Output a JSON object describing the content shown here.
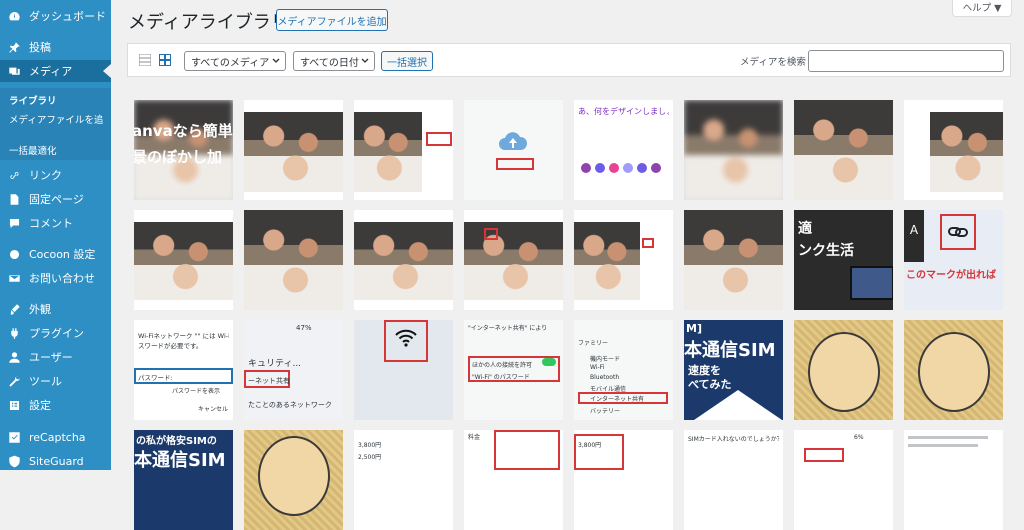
{
  "sidebar": {
    "items": [
      {
        "label": "ダッシュボード",
        "icon": "dashboard-icon"
      },
      {
        "label": "投稿",
        "icon": "pin-icon"
      },
      {
        "label": "メディア",
        "icon": "media-icon"
      },
      {
        "label": "リンク",
        "icon": "link-icon"
      },
      {
        "label": "固定ページ",
        "icon": "page-icon"
      },
      {
        "label": "コメント",
        "icon": "comment-icon"
      },
      {
        "label": "Cocoon 設定",
        "icon": "cocoon-icon"
      },
      {
        "label": "お問い合わせ",
        "icon": "mail-icon"
      },
      {
        "label": "外観",
        "icon": "brush-icon"
      },
      {
        "label": "プラグイン",
        "icon": "plugin-icon"
      },
      {
        "label": "ユーザー",
        "icon": "user-icon"
      },
      {
        "label": "ツール",
        "icon": "wrench-icon"
      },
      {
        "label": "設定",
        "icon": "settings-icon"
      },
      {
        "label": "reCaptcha",
        "icon": "check-icon"
      },
      {
        "label": "SiteGuard",
        "icon": "shield-icon"
      }
    ],
    "submenu": [
      "ライブラリ",
      "メディアファイルを追",
      "一括最適化"
    ]
  },
  "header": {
    "title": "メディアライブラリ",
    "add_new": "メディアファイルを追加",
    "help": "ヘルプ ▼"
  },
  "filters": {
    "type": "すべてのメディア",
    "date": "すべての日付",
    "bulk_select": "一括選択",
    "search_label": "メディアを検索",
    "search_value": ""
  },
  "thumbs": {
    "canva_line1": "anvaなら簡単",
    "canva_line2": "景のぼかし加",
    "wifi_title": "Wi-Fiネットワーク \"\" には Wi-Fi",
    "wifi_sub": "スワードが必要です。",
    "wifi_pass_label": "パスワード:",
    "wifi_show": "パスワードを表示",
    "wifi_cancel": "キャンセル",
    "security": "キュリティ...",
    "net_share": "ーネット共有",
    "network_text": "たことのあるネットワーク",
    "battery": "47%",
    "sim_label": "M]",
    "sim_line1": "本通信SIM",
    "sim_line2": "速度を",
    "sim_line3": "べてみた",
    "sim2_line1": "の私が格安SIMの",
    "sim2_line2": "本通信SIM",
    "canva2": "あ、何をデザインしましょう",
    "link_text": "このマークが出れば",
    "tech1": "適",
    "tech2": "ンク生活",
    "letter_a": "A",
    "internet_share": "インターネット共有",
    "settings_rows": [
      "機内モード",
      "Wi-Fi",
      "Bluetooth",
      "モバイル通信",
      "インターネット共有",
      "バッテリー"
    ],
    "family": "ファミリー",
    "pref1": "ほかの人の接続を許可",
    "pref2": "\"Wi-Fi\" のパスワード",
    "pref_head": "\"インターネット共有\" により",
    "table_head": "料金",
    "price1": "3,800円",
    "price2": "2,500円",
    "q_text": "SIMカード入れないのでしょうか？",
    "zoom": "6%"
  }
}
